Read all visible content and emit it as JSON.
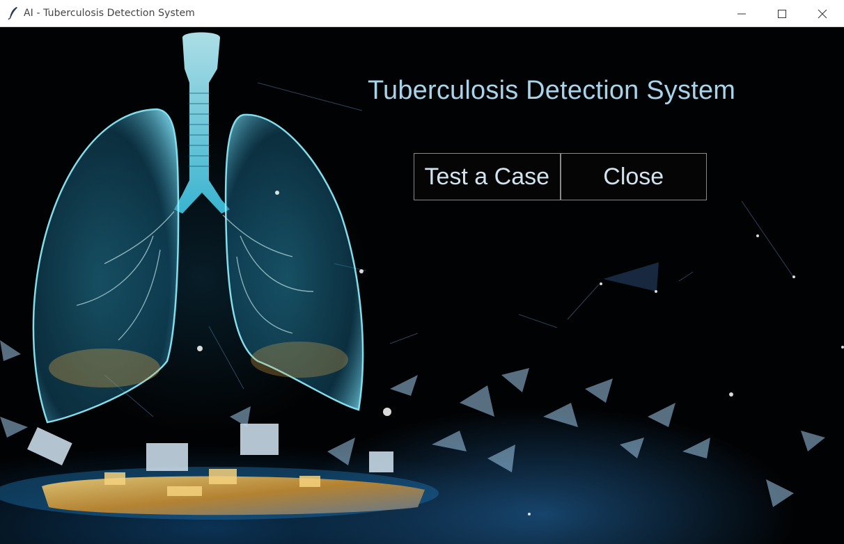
{
  "window": {
    "title": "AI - Tuberculosis Detection System",
    "app_icon": "feather-icon",
    "controls": [
      "minimize-icon",
      "maximize-icon",
      "close-icon"
    ]
  },
  "main": {
    "heading": "Tuberculosis Detection System",
    "buttons": {
      "test_case": "Test a Case",
      "close": "Close"
    },
    "background_image": "glowing-lungs-network-illustration"
  },
  "colors": {
    "heading": "#a7d4ea",
    "button_text": "#cfe4ee",
    "button_border": "#8a8a8a",
    "background": "#010203"
  }
}
